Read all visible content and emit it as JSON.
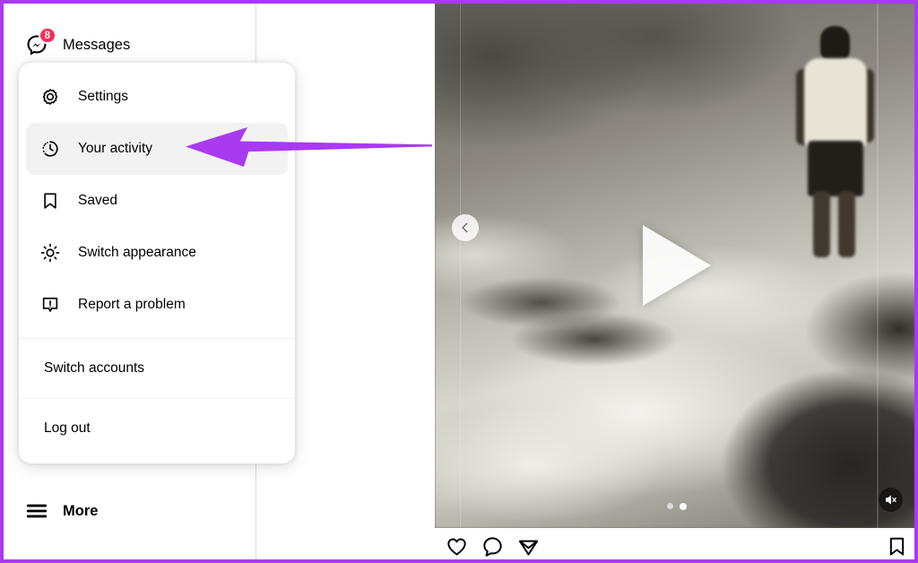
{
  "app": {
    "name": "Instagram Web",
    "accent_purple": "#a93af0",
    "badge_color": "#fc2d55"
  },
  "sidebar": {
    "items": [
      {
        "label": "Messages",
        "icon": "messenger-icon",
        "badge": "8"
      },
      {
        "label": "More",
        "icon": "hamburger-menu-icon",
        "badge": ""
      }
    ]
  },
  "popup_menu": {
    "items": [
      {
        "label": "Settings",
        "icon": "gear-icon",
        "active": false
      },
      {
        "label": "Your activity",
        "icon": "clock-history-icon",
        "active": true
      },
      {
        "label": "Saved",
        "icon": "bookmark-icon",
        "active": false
      },
      {
        "label": "Switch appearance",
        "icon": "sun-icon",
        "active": false
      },
      {
        "label": "Report a problem",
        "icon": "report-problem-icon",
        "active": false
      }
    ],
    "plain_items": [
      {
        "label": "Switch accounts"
      },
      {
        "label": "Log out"
      }
    ]
  },
  "post": {
    "media_type": "video",
    "play_button": "play-icon",
    "prev_button": "chevron-left-icon",
    "mute_button": "speaker-muted-icon",
    "carousel": {
      "total": 2,
      "active_index": 1
    },
    "actions": [
      {
        "name": "like",
        "icon": "heart-icon"
      },
      {
        "name": "comment",
        "icon": "comment-bubble-icon"
      },
      {
        "name": "share",
        "icon": "paper-plane-icon"
      },
      {
        "name": "save",
        "icon": "bookmark-icon"
      }
    ]
  },
  "annotation": {
    "type": "arrow",
    "color": "#a93af0",
    "points_to": "Your activity"
  }
}
